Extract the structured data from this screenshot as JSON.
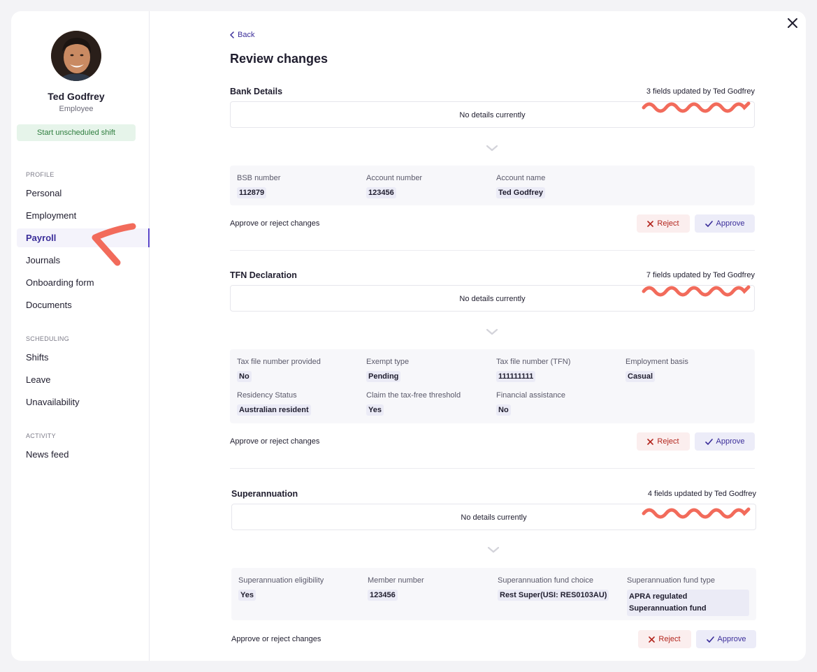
{
  "profile": {
    "name": "Ted Godfrey",
    "role": "Employee",
    "shift_button": "Start unscheduled shift"
  },
  "sidebar": {
    "profile_heading": "PROFILE",
    "profile_items": [
      "Personal",
      "Employment",
      "Payroll",
      "Journals",
      "Onboarding form",
      "Documents"
    ],
    "active_item": "Payroll",
    "scheduling_heading": "SCHEDULING",
    "scheduling_items": [
      "Shifts",
      "Leave",
      "Unavailability"
    ],
    "activity_heading": "ACTIVITY",
    "activity_items": [
      "News feed"
    ]
  },
  "header": {
    "back_label": "Back",
    "title": "Review changes"
  },
  "sections": [
    {
      "title": "Bank Details",
      "meta": "3 fields updated by Ted Godfrey",
      "current": "No details currently",
      "fields": [
        {
          "label": "BSB number",
          "value": "112879"
        },
        {
          "label": "Account number",
          "value": "123456"
        },
        {
          "label": "Account name",
          "value": "Ted Godfrey"
        }
      ],
      "action_text": "Approve or reject changes",
      "reject_label": "Reject",
      "approve_label": "Approve"
    },
    {
      "title": "TFN Declaration",
      "meta": "7 fields updated by Ted Godfrey",
      "current": "No details currently",
      "fields": [
        {
          "label": "Tax file number provided",
          "value": "No"
        },
        {
          "label": "Exempt type",
          "value": "Pending"
        },
        {
          "label": "Tax file number (TFN)",
          "value": "111111111"
        },
        {
          "label": "Employment basis",
          "value": "Casual"
        },
        {
          "label": "Residency Status",
          "value": "Australian resident"
        },
        {
          "label": "Claim the tax-free threshold",
          "value": "Yes"
        },
        {
          "label": "Financial assistance",
          "value": "No"
        }
      ],
      "action_text": "Approve or reject changes",
      "reject_label": "Reject",
      "approve_label": "Approve"
    },
    {
      "title": "Superannuation",
      "meta": "4 fields updated by Ted Godfrey",
      "current": "No details currently",
      "fields": [
        {
          "label": "Superannuation eligibility",
          "value": "Yes"
        },
        {
          "label": "Member number",
          "value": "123456"
        },
        {
          "label": "Superannuation fund choice",
          "value": "Rest Super(USI: RES0103AU)"
        },
        {
          "label": "Superannuation fund type",
          "value": "APRA regulated Superannuation fund"
        }
      ],
      "action_text": "Approve or reject changes",
      "reject_label": "Reject",
      "approve_label": "Approve"
    }
  ],
  "colors": {
    "accent": "#3b2e9a",
    "annotation": "#f26b5b",
    "reject": "#b3261e",
    "shift_green": "#2e7d3e"
  },
  "icons": [
    "chevron-left-icon",
    "close-icon",
    "chevron-down-icon",
    "x-icon",
    "check-icon"
  ]
}
